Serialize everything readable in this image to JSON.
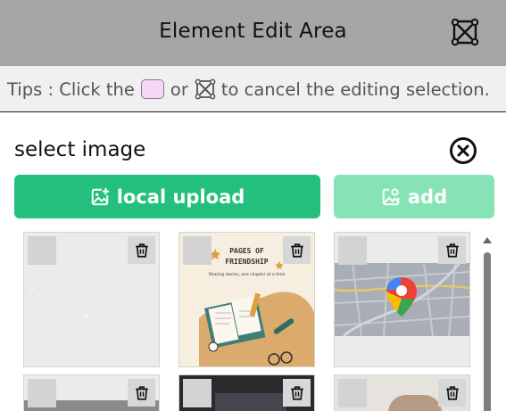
{
  "header": {
    "title": "Element Edit Area",
    "close_icon": "close-x-square-icon"
  },
  "tips": {
    "prefix": "Tips : Click the",
    "middle": "or",
    "suffix": "to cancel the editing selection.",
    "swatch_color": "#f4d8f6"
  },
  "section": {
    "title": "select image",
    "close_icon": "circle-x-icon"
  },
  "buttons": {
    "upload_label": "local upload",
    "add_label": "add",
    "upload_color": "#22c07c",
    "add_color": "#86e3b6"
  },
  "thumbnails": [
    {
      "kind": "blank"
    },
    {
      "kind": "book-cover",
      "title_line1": "PAGES OF",
      "title_line2": "FRIENDSHIP",
      "subtitle": "Sharing stories, one chapter at a time"
    },
    {
      "kind": "map",
      "icon": "map-pin-icon"
    },
    {
      "kind": "photo"
    },
    {
      "kind": "photo"
    },
    {
      "kind": "photo"
    }
  ]
}
